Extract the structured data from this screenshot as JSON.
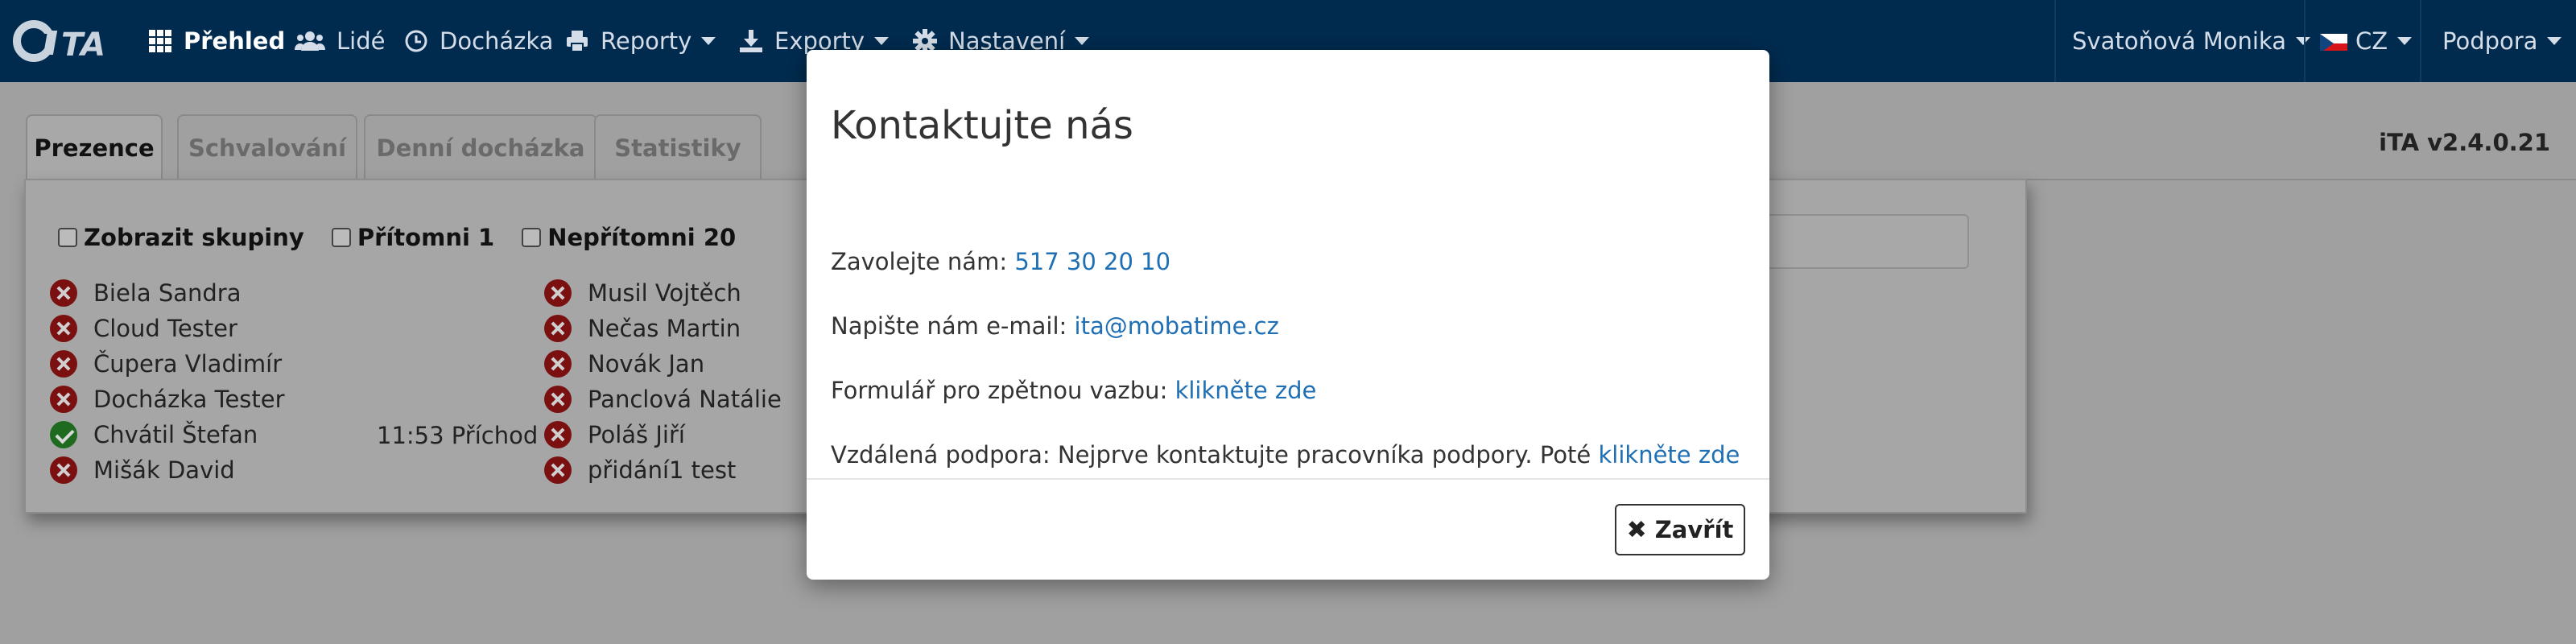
{
  "navbar": {
    "logo_text": "iTA",
    "items": [
      {
        "label": "Přehled",
        "icon": "grid-icon",
        "active": true,
        "dropdown": false
      },
      {
        "label": "Lidé",
        "icon": "users-icon",
        "active": false,
        "dropdown": false
      },
      {
        "label": "Docházka",
        "icon": "clock-icon",
        "active": false,
        "dropdown": false
      },
      {
        "label": "Reporty",
        "icon": "printer-icon",
        "active": false,
        "dropdown": true
      },
      {
        "label": "Exporty",
        "icon": "download-icon",
        "active": false,
        "dropdown": true
      },
      {
        "label": "Nastavení",
        "icon": "gear-icon",
        "active": false,
        "dropdown": true
      }
    ],
    "user_name": "Svatoňová Monika",
    "language": "CZ",
    "support": "Podpora"
  },
  "tabs": [
    {
      "label": "Prezence",
      "active": true
    },
    {
      "label": "Schvalování",
      "active": false
    },
    {
      "label": "Denní docházka",
      "active": false
    },
    {
      "label": "Statistiky",
      "active": false
    }
  ],
  "version": "iTA v2.4.0.21",
  "filters": {
    "show_groups": "Zobrazit skupiny",
    "present": "Přítomni 1",
    "absent": "Nepřítomni 20"
  },
  "people_left": [
    {
      "name": "Biela Sandra",
      "status": "absent"
    },
    {
      "name": "Cloud Tester",
      "status": "absent"
    },
    {
      "name": "Čupera Vladimír",
      "status": "absent"
    },
    {
      "name": "Docházka Tester",
      "status": "absent"
    },
    {
      "name": "Chvátil Štefan",
      "status": "present",
      "arrival": "11:53 Příchod"
    },
    {
      "name": "Mišák David",
      "status": "absent"
    }
  ],
  "people_right": [
    {
      "name": "Musil Vojtěch",
      "status": "absent"
    },
    {
      "name": "Nečas Martin",
      "status": "absent"
    },
    {
      "name": "Novák Jan",
      "status": "absent"
    },
    {
      "name": "Panclová Natálie",
      "status": "absent"
    },
    {
      "name": "Poláš Jiří",
      "status": "absent"
    },
    {
      "name": "přidání1 test",
      "status": "absent"
    }
  ],
  "modal": {
    "title": "Kontaktujte nás",
    "phone_label": "Zavolejte nám: ",
    "phone": "517 30 20 10",
    "email_label": "Napište nám e-mail: ",
    "email": "ita@mobatime.cz",
    "feedback_label": "Formulář pro zpětnou vazbu: ",
    "feedback_link": "klikněte zde",
    "remote_label": "Vzdálená podpora: Nejprve kontaktujte pracovníka podpory. Poté ",
    "remote_link": "klikněte zde",
    "close_label": "Zavřít"
  },
  "colors": {
    "navbar": "#002b4f",
    "link": "#1f6fb5",
    "absent": "#a31515",
    "present": "#2a8f2a"
  }
}
